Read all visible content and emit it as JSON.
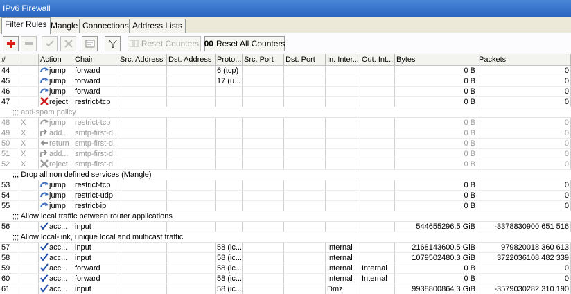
{
  "window": {
    "title": "IPv6 Firewall"
  },
  "tabs": [
    "Filter Rules",
    "Mangle",
    "Connections",
    "Address Lists"
  ],
  "toolbar": {
    "reset_counters": "Reset Counters",
    "reset_all_counters": "Reset All Counters",
    "reset_all_prefix": "00"
  },
  "columns": [
    "#",
    "",
    "Action",
    "Chain",
    "Src. Address",
    "Dst. Address",
    "Proto...",
    "Src. Port",
    "Dst. Port",
    "In. Inter...",
    "Out. Int...",
    "Bytes",
    "Packets"
  ],
  "rows": [
    {
      "kind": "rule",
      "num": "44",
      "x": "",
      "icon": "jump-icon",
      "action": "jump",
      "chain": "forward",
      "proto": "6 (tcp)",
      "in": "",
      "out": "",
      "bytes": "0 B",
      "packets": "0",
      "disabled": false
    },
    {
      "kind": "rule",
      "num": "45",
      "x": "",
      "icon": "jump-icon",
      "action": "jump",
      "chain": "forward",
      "proto": "17 (u...",
      "in": "",
      "out": "",
      "bytes": "0 B",
      "packets": "0",
      "disabled": false
    },
    {
      "kind": "rule",
      "num": "46",
      "x": "",
      "icon": "jump-icon",
      "action": "jump",
      "chain": "forward",
      "proto": "",
      "in": "",
      "out": "",
      "bytes": "0 B",
      "packets": "0",
      "disabled": false
    },
    {
      "kind": "rule",
      "num": "47",
      "x": "",
      "icon": "reject-icon",
      "action": "reject",
      "chain": "restrict-tcp",
      "proto": "",
      "in": "",
      "out": "",
      "bytes": "0 B",
      "packets": "0",
      "disabled": false
    },
    {
      "kind": "comment",
      "text": ";;; anti-spam policy",
      "disabled": true
    },
    {
      "kind": "rule",
      "num": "48",
      "x": "X",
      "icon": "jump-icon",
      "action": "jump",
      "chain": "restrict-tcp",
      "proto": "",
      "in": "",
      "out": "",
      "bytes": "0 B",
      "packets": "0",
      "disabled": true
    },
    {
      "kind": "rule",
      "num": "49",
      "x": "X",
      "icon": "add-icon",
      "action": "add...",
      "chain": "smtp-first-d...",
      "proto": "",
      "in": "",
      "out": "",
      "bytes": "0 B",
      "packets": "0",
      "disabled": true
    },
    {
      "kind": "rule",
      "num": "50",
      "x": "X",
      "icon": "return-icon",
      "action": "return",
      "chain": "smtp-first-d...",
      "proto": "",
      "in": "",
      "out": "",
      "bytes": "0 B",
      "packets": "0",
      "disabled": true
    },
    {
      "kind": "rule",
      "num": "51",
      "x": "X",
      "icon": "add-icon",
      "action": "add...",
      "chain": "smtp-first-d...",
      "proto": "",
      "in": "",
      "out": "",
      "bytes": "0 B",
      "packets": "0",
      "disabled": true
    },
    {
      "kind": "rule",
      "num": "52",
      "x": "X",
      "icon": "reject-icon",
      "action": "reject",
      "chain": "smtp-first-d...",
      "proto": "",
      "in": "",
      "out": "",
      "bytes": "0 B",
      "packets": "0",
      "disabled": true
    },
    {
      "kind": "comment",
      "text": ";;; Drop all non defined services (Mangle)",
      "disabled": false
    },
    {
      "kind": "rule",
      "num": "53",
      "x": "",
      "icon": "jump-icon",
      "action": "jump",
      "chain": "restrict-tcp",
      "proto": "",
      "in": "",
      "out": "",
      "bytes": "0 B",
      "packets": "0",
      "disabled": false
    },
    {
      "kind": "rule",
      "num": "54",
      "x": "",
      "icon": "jump-icon",
      "action": "jump",
      "chain": "restrict-udp",
      "proto": "",
      "in": "",
      "out": "",
      "bytes": "0 B",
      "packets": "0",
      "disabled": false
    },
    {
      "kind": "rule",
      "num": "55",
      "x": "",
      "icon": "jump-icon",
      "action": "jump",
      "chain": "restrict-ip",
      "proto": "",
      "in": "",
      "out": "",
      "bytes": "0 B",
      "packets": "0",
      "disabled": false
    },
    {
      "kind": "comment",
      "text": ";;; Allow local traffic between router applications",
      "disabled": false
    },
    {
      "kind": "rule",
      "num": "56",
      "x": "",
      "icon": "accept-icon",
      "action": "acc...",
      "chain": "input",
      "proto": "",
      "in": "",
      "out": "",
      "bytes": "544655296.5 GiB",
      "packets": "-3378830900 651 516",
      "disabled": false
    },
    {
      "kind": "comment",
      "text": ";;; Allow local-link, unique local and multicast traffic",
      "disabled": false
    },
    {
      "kind": "rule",
      "num": "57",
      "x": "",
      "icon": "accept-icon",
      "action": "acc...",
      "chain": "input",
      "proto": "58 (ic...",
      "in": "Internal",
      "out": "",
      "bytes": "2168143600.5 GiB",
      "packets": "979820018 360 613",
      "disabled": false
    },
    {
      "kind": "rule",
      "num": "58",
      "x": "",
      "icon": "accept-icon",
      "action": "acc...",
      "chain": "input",
      "proto": "58 (ic...",
      "in": "Internal",
      "out": "",
      "bytes": "1079502480.3 GiB",
      "packets": "3722036108 482 339",
      "disabled": false
    },
    {
      "kind": "rule",
      "num": "59",
      "x": "",
      "icon": "accept-icon",
      "action": "acc...",
      "chain": "forward",
      "proto": "58 (ic...",
      "in": "Internal",
      "out": "Internal",
      "bytes": "0 B",
      "packets": "0",
      "disabled": false
    },
    {
      "kind": "rule",
      "num": "60",
      "x": "",
      "icon": "accept-icon",
      "action": "acc...",
      "chain": "forward",
      "proto": "58 (ic...",
      "in": "Internal",
      "out": "Internal",
      "bytes": "0 B",
      "packets": "0",
      "disabled": false
    },
    {
      "kind": "rule",
      "num": "61",
      "x": "",
      "icon": "accept-icon",
      "action": "acc...",
      "chain": "input",
      "proto": "58 (ic...",
      "in": "Dmz",
      "out": "",
      "bytes": "9938800864.3 GiB",
      "packets": "-3579030282 310 190",
      "disabled": false
    }
  ]
}
